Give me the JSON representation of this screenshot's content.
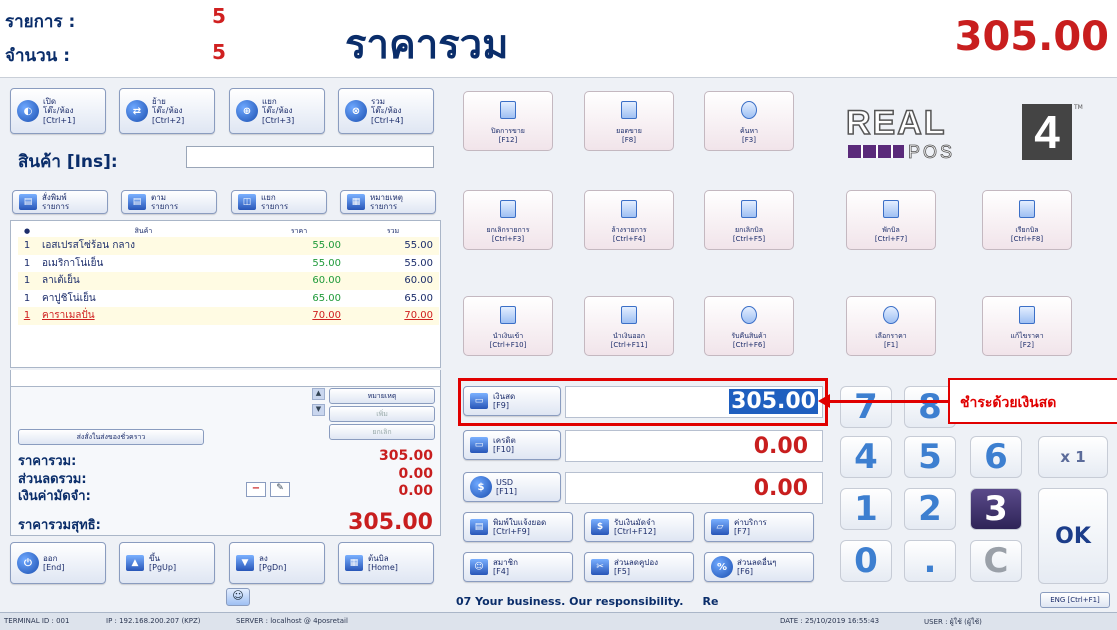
{
  "header": {
    "items_label": "รายการ :",
    "items_count": "5",
    "quantity_label": "จำนวน :",
    "quantity_count": "5",
    "title": "ราคารวม",
    "total": "305.00"
  },
  "table_buttons": [
    {
      "label": "เปิด\nโต๊ะ/ห้อง\n[Ctrl+1]",
      "icon": "open-table-icon"
    },
    {
      "label": "ย้าย\nโต๊ะ/ห้อง\n[Ctrl+2]",
      "icon": "move-table-icon"
    },
    {
      "label": "แยก\nโต๊ะ/ห้อง\n[Ctrl+3]",
      "icon": "split-table-icon"
    },
    {
      "label": "รวม\nโต๊ะ/ห้อง\n[Ctrl+4]",
      "icon": "merge-table-icon"
    }
  ],
  "product": {
    "label": "สินค้า [Ins]:",
    "value": ""
  },
  "list_buttons": [
    {
      "label": "สั่งพิมพ์\nรายการ",
      "icon": "print-list-icon"
    },
    {
      "label": "ตาม\nรายการ",
      "icon": "follow-list-icon"
    },
    {
      "label": "แยก\nรายการ",
      "icon": "split-list-icon"
    },
    {
      "label": "หมายเหตุ\nรายการ",
      "icon": "note-list-icon"
    }
  ],
  "order_table": {
    "headers": [
      "●",
      "สินค้า",
      "ราคา",
      "รวม"
    ],
    "rows": [
      {
        "qty": "1",
        "name": "เอสเปรสโซ่ร้อน กลาง",
        "price": "55.00",
        "total": "55.00"
      },
      {
        "qty": "1",
        "name": "อเมริกาโน่เย็น",
        "price": "55.00",
        "total": "55.00"
      },
      {
        "qty": "1",
        "name": "ลาเต้เย็น",
        "price": "60.00",
        "total": "60.00"
      },
      {
        "qty": "1",
        "name": "คาปูชิโน่เย็น",
        "price": "65.00",
        "total": "65.00"
      },
      {
        "qty": "1",
        "name": "คาราเมลปั่น",
        "price": "70.00",
        "total": "70.00"
      }
    ]
  },
  "side_buttons": {
    "note": "หมายเหตุ",
    "add": "เพิ่ม",
    "cancel": "ยกเลิก"
  },
  "hold_button": "ส่งสั่งในส่งของชั่วคราว",
  "summary": {
    "subtotal_label": "ราคารวม:",
    "subtotal": "305.00",
    "discount_label": "ส่วนลดรวม:",
    "discount": "0.00",
    "deposit_label": "เงินค่ามัดจำ:",
    "deposit": "0.00",
    "net_label": "ราคารวมสุทธิ:",
    "net": "305.00"
  },
  "nav_buttons": [
    {
      "label": "ออก\n[End]",
      "icon": "exit-icon"
    },
    {
      "label": "ขึ้น\n[PgUp]",
      "icon": "arrow-up-icon"
    },
    {
      "label": "ลง\n[PgDn]",
      "icon": "arrow-down-icon"
    },
    {
      "label": "ต้นบิล\n[Home]",
      "icon": "home-bill-icon"
    }
  ],
  "function_tiles": [
    {
      "label": "ปิดการขาย\n[F12]"
    },
    {
      "label": "ยอดขาย\n[F8]"
    },
    {
      "label": "ค้นหา\n[F3]"
    },
    {
      "label": "ยกเลิกรายการ\n[Ctrl+F3]"
    },
    {
      "label": "ล้างรายการ\n[Ctrl+F4]"
    },
    {
      "label": "ยกเลิกบิล\n[Ctrl+F5]"
    },
    {
      "label": "พักบิล\n[Ctrl+F7]"
    },
    {
      "label": "เรียกบิล\n[Ctrl+F8]"
    },
    {
      "label": "นำเงินเข้า\n[Ctrl+F10]"
    },
    {
      "label": "นำเงินออก\n[Ctrl+F11]"
    },
    {
      "label": "รับคืนสินค้า\n[Ctrl+F6]"
    },
    {
      "label": "เลือกราคา\n[F1]"
    },
    {
      "label": "แก้ไขราคา\n[F2]"
    }
  ],
  "logo": {
    "brand": "REAL",
    "sub": "POS",
    "number": "4",
    "tm": "TM"
  },
  "payment": {
    "cash_label": "เงินสด\n[F9]",
    "cash_amount": "305.00",
    "credit_label": "เครดิต\n[F10]",
    "credit_amount": "0.00",
    "usd_label": "USD\n[F11]",
    "usd_amount": "0.00"
  },
  "annotation": "ชำระด้วยเงินสด",
  "action_buttons": [
    {
      "label": "พิมพ์ใบแจ้งยอด\n[Ctrl+F9]"
    },
    {
      "label": "รับเงินมัดจำ\n[Ctrl+F12]"
    },
    {
      "label": "ค่าบริการ\n[F7]"
    },
    {
      "label": "สมาชิก\n[F4]"
    },
    {
      "label": "ส่วนลดคูปอง\n[F5]"
    },
    {
      "label": "ส่วนลดอื่นๆ\n[F6]"
    }
  ],
  "keypad": {
    "keys": [
      "7",
      "8",
      "4",
      "5",
      "6",
      "x 1",
      "1",
      "2",
      "3",
      "OK",
      "0",
      ".",
      "C"
    ]
  },
  "marquee": "07 Your business. Our responsibility.     Re",
  "eng_button": "ENG [Ctrl+F1]",
  "status_bar": {
    "terminal": "TERMINAL ID : 001",
    "ip": "IP : 192.168.200.207 (KPZ)",
    "server": "SERVER : localhost @ 4posretail",
    "date": "DATE : 25/10/2019  16:55:43",
    "user": "USER : ผู้ใช้ (ผู้ใช้)"
  },
  "colors": {
    "accent": "#0a2d6a",
    "total": "#c81e1e",
    "annotation": "#e00000"
  }
}
